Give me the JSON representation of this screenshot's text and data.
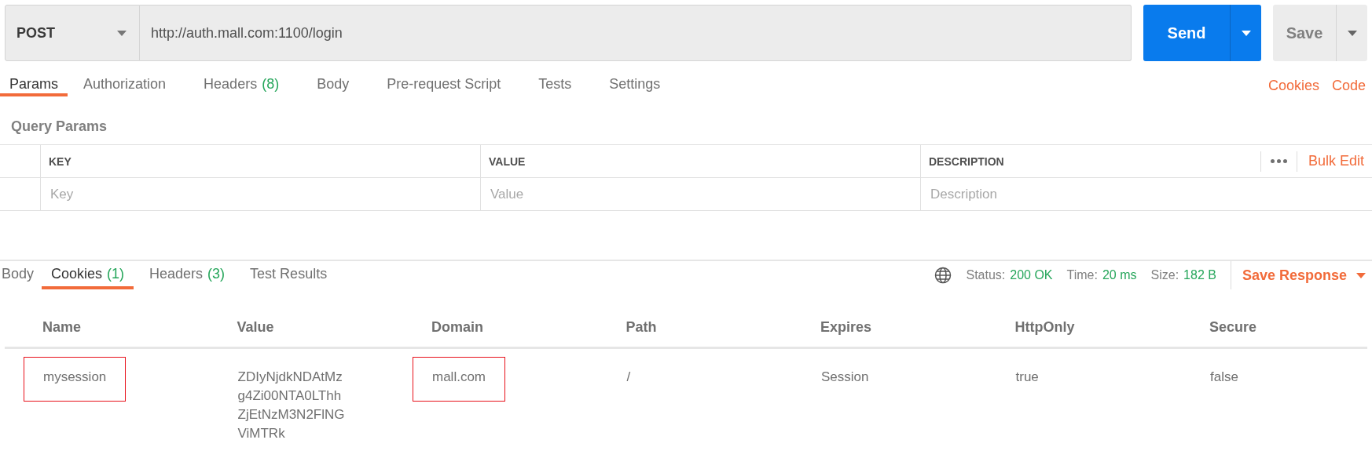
{
  "request": {
    "method": "POST",
    "url": "http://auth.mall.com:1100/login",
    "send_label": "Send",
    "save_label": "Save"
  },
  "request_tabs": [
    {
      "label": "Params",
      "selected": true
    },
    {
      "label": "Authorization",
      "selected": false
    },
    {
      "label": "Headers",
      "count": "(8)",
      "selected": false
    },
    {
      "label": "Body",
      "selected": false
    },
    {
      "label": "Pre-request Script",
      "selected": false
    },
    {
      "label": "Tests",
      "selected": false
    },
    {
      "label": "Settings",
      "selected": false
    }
  ],
  "request_links": [
    "Cookies",
    "Code"
  ],
  "query_params": {
    "title": "Query Params",
    "columns": [
      "KEY",
      "VALUE",
      "DESCRIPTION"
    ],
    "bulk_edit": "Bulk Edit",
    "placeholders": [
      "Key",
      "Value",
      "Description"
    ]
  },
  "response_tabs": [
    {
      "label": "Body",
      "selected": false
    },
    {
      "label": "Cookies",
      "count": "(1)",
      "selected": true
    },
    {
      "label": "Headers",
      "count": "(3)",
      "selected": false
    },
    {
      "label": "Test Results",
      "selected": false
    }
  ],
  "response_meta": [
    {
      "label": "Status:",
      "value": "200 OK"
    },
    {
      "label": "Time:",
      "value": "20 ms"
    },
    {
      "label": "Size:",
      "value": "182 B"
    }
  ],
  "save_response": "Save Response",
  "cookies": {
    "columns": [
      "Name",
      "Value",
      "Domain",
      "Path",
      "Expires",
      "HttpOnly",
      "Secure"
    ],
    "rows": [
      {
        "cells": [
          {
            "text": "mysession",
            "highlighted": true
          },
          {
            "text": "ZDIyNjdkNDAtMzg4Zi00NTA0LThhZjEtNzM3N2FlNGViMTRk",
            "highlighted": false
          },
          {
            "text": "mall.com",
            "highlighted": true
          },
          {
            "text": "/",
            "highlighted": false
          },
          {
            "text": "Session",
            "highlighted": false
          },
          {
            "text": "true",
            "highlighted": false
          },
          {
            "text": "false",
            "highlighted": false
          }
        ]
      }
    ]
  }
}
